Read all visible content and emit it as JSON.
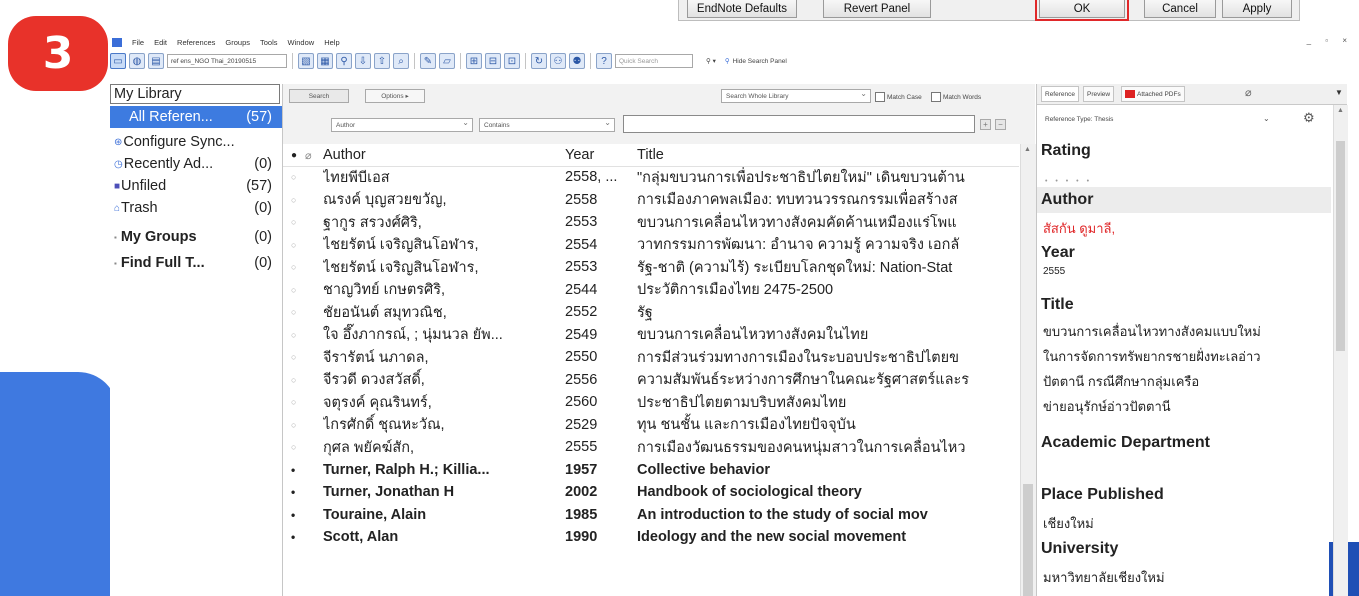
{
  "step_badge": "3",
  "dialog": {
    "buttons": [
      "EndNote Defaults",
      "Revert Panel",
      "OK",
      "Cancel",
      "Apply"
    ]
  },
  "menu": [
    "File",
    "Edit",
    "References",
    "Groups",
    "Tools",
    "Window",
    "Help"
  ],
  "window_controls": "_ ▫ ×",
  "toolbar": {
    "library_name": "ref ens_NGO Thai_20190515",
    "quick_search_placeholder": "Quick Search",
    "hide_search_label": "Hide Search Panel"
  },
  "library": {
    "title": "My Library",
    "items": [
      {
        "label": "All Referen...",
        "count": "(57)",
        "icon": "folder-icon"
      },
      {
        "label": "Configure Sync...",
        "count": "",
        "icon": "sync-icon"
      },
      {
        "label": "Recently Ad...",
        "count": "(0)",
        "icon": "clock-icon"
      },
      {
        "label": "Unfiled",
        "count": "(57)",
        "icon": "unfiled-icon"
      },
      {
        "label": "Trash",
        "count": "(0)",
        "icon": "trash-icon"
      },
      {
        "label": "My Groups",
        "count": "(0)",
        "icon": "group-icon"
      },
      {
        "label": "Find Full T...",
        "count": "(0)",
        "icon": "find-icon"
      }
    ]
  },
  "search": {
    "search_button": "Search",
    "options_button": "Options ▸",
    "scope": "Search Whole Library",
    "match_case": "Match Case",
    "match_words": "Match Words",
    "field": "Author",
    "operator": "Contains"
  },
  "list": {
    "headers": {
      "author": "Author",
      "year": "Year",
      "title": "Title"
    },
    "rows": [
      {
        "author": "ไทยพีบีเอส",
        "year": "2558, ...",
        "title": "\"กลุ่มขบวนการเพื่อประชาธิปไตยใหม่\" เดินขบวนต้าน",
        "bold": false
      },
      {
        "author": "ณรงค์ บุญสวยขวัญ,",
        "year": "2558",
        "title": "การเมืองภาคพลเมือง: ทบทวนวรรณกรรมเพื่อสร้างส",
        "bold": false
      },
      {
        "author": "ฐากูร สรวงศ์ศิริ,",
        "year": "2553",
        "title": "ขบวนการเคลื่อนไหวทางสังคมคัดค้านเหมืองแร่โพแ",
        "bold": false
      },
      {
        "author": "ไชยรัตน์ เจริญสินโอฬาร,",
        "year": "2554",
        "title": "วาทกรรมการพัฒนา: อำนาจ ความรู้ ความจริง เอกลั",
        "bold": false
      },
      {
        "author": "ไชยรัตน์ เจริญสินโอฬาร,",
        "year": "2553",
        "title": "รัฐ-ชาติ (ความไร้) ระเบียบโลกชุดใหม่: Nation-Stat",
        "bold": false
      },
      {
        "author": "ชาญวิทย์ เกษตรศิริ,",
        "year": "2544",
        "title": "ประวัติการเมืองไทย 2475-2500",
        "bold": false
      },
      {
        "author": "ชัยอนันต์ สมุทวณิช,",
        "year": "2552",
        "title": "รัฐ",
        "bold": false
      },
      {
        "author": "ใจ อึ๊งภากรณ์, ; นุ่มนวล ยัพ...",
        "year": "2549",
        "title": "ขบวนการเคลื่อนไหวทางสังคมในไทย",
        "bold": false
      },
      {
        "author": "จีรารัตน์ นภาดล,",
        "year": "2550",
        "title": "การมีส่วนร่วมทางการเมืองในระบอบประชาธิปไตยข",
        "bold": false
      },
      {
        "author": "จีรวดี ดวงสวัสดิ์,",
        "year": "2556",
        "title": "ความสัมพันธ์ระหว่างการศึกษาในคณะรัฐศาสตร์และร",
        "bold": false
      },
      {
        "author": "จตุรงค์ คุณรินทร์,",
        "year": "2560",
        "title": "ประชาธิปไตยตามบริบทสังคมไทย",
        "bold": false
      },
      {
        "author": "ไกรศักดิ์ ชุณหะวัณ,",
        "year": "2529",
        "title": "ทุน ชนชั้น และการเมืองไทยปัจจุบัน",
        "bold": false
      },
      {
        "author": "กุศล พยัคฆ์สัก,",
        "year": "2555",
        "title": "การเมืองวัฒนธรรมของคนหนุ่มสาวในการเคลื่อนไหว",
        "bold": false
      },
      {
        "author": "Turner, Ralph H.; Killia...",
        "year": "1957",
        "title": "Collective behavior",
        "bold": true
      },
      {
        "author": "Turner, Jonathan H",
        "year": "2002",
        "title": "Handbook of sociological theory",
        "bold": true
      },
      {
        "author": "Touraine, Alain",
        "year": "1985",
        "title": "An introduction to the study of social mov",
        "bold": true
      },
      {
        "author": "Scott, Alan",
        "year": "1990",
        "title": "Ideology and the new social movement",
        "bold": true
      }
    ]
  },
  "reference": {
    "tabs": [
      "Reference",
      "Preview",
      "Attached PDFs"
    ],
    "type_label": "Reference Type:",
    "type_value": "Thesis",
    "rating_label": "Rating",
    "rating_stars": "• • • • •",
    "author_label": "Author",
    "author_value": "สัสกัน ดูมาลี,",
    "year_label": "Year",
    "year_value": "2555",
    "title_label": "Title",
    "title_lines": [
      "ขบวนการเคลื่อนไหวทางสังคมแบบใหม่",
      "ในการจัดการทรัพยากรชายฝั่งทะเลอ่าว",
      "ปัตตานี กรณีศึกษากลุ่มเครือ",
      "ข่ายอนุรักษ์อ่าวปัตตานี"
    ],
    "dept_label": "Academic Department",
    "place_label": "Place Published",
    "place_value": "เชียงใหม่",
    "univ_label": "University",
    "univ_value": "มหาวิทยาลัยเชียงใหม่"
  },
  "colors": {
    "selection": "#3d7be0",
    "badge": "#e8322a",
    "ok_highlight": "#e0282a",
    "author_red": "#e0282a",
    "decoration_blue": "#3f79e0"
  }
}
